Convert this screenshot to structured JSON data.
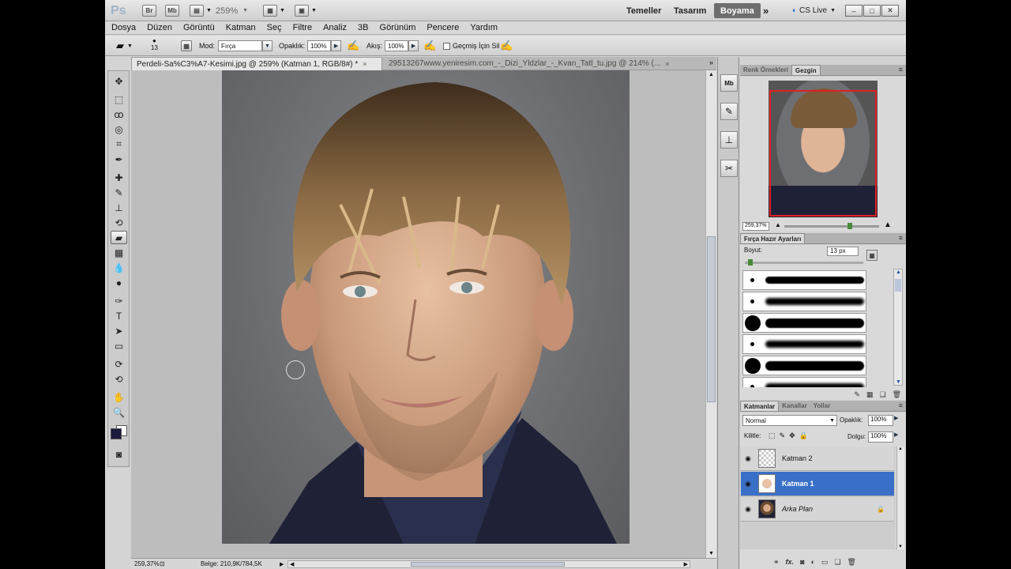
{
  "appbar": {
    "logo": "Ps",
    "bridge_label": "Br",
    "minibridge_label": "Mb",
    "zoom": "259%",
    "workspaces": [
      "Temeller",
      "Tasarım",
      "Boyama"
    ],
    "active_workspace": "Boyama",
    "more": "»",
    "cslive": "CS Live",
    "window_buttons": [
      "–",
      "□",
      "✕"
    ]
  },
  "menu": [
    "Dosya",
    "Düzen",
    "Görüntü",
    "Katman",
    "Seç",
    "Filtre",
    "Analiz",
    "3B",
    "Görünüm",
    "Pencere",
    "Yardım"
  ],
  "options": {
    "brush_size": "13",
    "mode_label": "Mod:",
    "mode_value": "Fırça",
    "opacity_label": "Opaklık:",
    "opacity_value": "100%",
    "flow_label": "Akış:",
    "flow_value": "100%",
    "history_label": "Geçmiş İçin Sil"
  },
  "tabs": [
    {
      "label": "Perdeli-Sa%C3%A7-Kesimi.jpg @ 259% (Katman 1, RGB/8#) *",
      "close": "×"
    },
    {
      "label": "29513267www.yeniresim.com_-_Dizi_Yldzlar_-_Kvan_Tatl_tu.jpg @ 214% (...",
      "close": "×"
    }
  ],
  "tools": [
    "move-tool",
    "marquee-tool",
    "lasso-tool",
    "quick-select-tool",
    "crop-tool",
    "eyedropper-tool",
    "healing-brush-tool",
    "brush-tool",
    "clone-stamp-tool",
    "history-brush-tool",
    "eraser-tool",
    "gradient-tool",
    "blur-tool",
    "dodge-tool",
    "pen-tool",
    "type-tool",
    "path-select-tool",
    "shape-tool",
    "3d-rotate-tool",
    "3d-orbit-tool",
    "hand-tool",
    "zoom-tool"
  ],
  "tool_glyphs": [
    "✥",
    "⬚",
    "ꝏ",
    "◎",
    "⌗",
    "✒",
    "✚",
    "✎",
    "⊥",
    "⟲",
    "▰",
    "▦",
    "💧",
    "●",
    "✑",
    "T",
    "➤",
    "▭",
    "⟳",
    "⟲",
    "✋",
    "🔍"
  ],
  "status": {
    "zoom": "259,37%",
    "doc": "Belge: 210,9K/784,5K"
  },
  "navigator": {
    "tabs": [
      "Renk Örnekleri",
      "Gezgin"
    ],
    "active_tab": "Gezgin",
    "zoom": "259,37%"
  },
  "brush_presets": {
    "title": "Fırça Hazır Ayarları",
    "size_label": "Boyut:",
    "size_value": "13 px"
  },
  "layers": {
    "tabs": [
      "Katmanlar",
      "Kanallar",
      "Yollar"
    ],
    "active_tab": "Katmanlar",
    "blend_mode": "Normal",
    "opacity_label": "Opaklık:",
    "opacity_value": "100%",
    "lock_label": "Kilitle:",
    "fill_label": "Dolgu:",
    "fill_value": "100%",
    "items": [
      {
        "name": "Katman 2",
        "selected": false
      },
      {
        "name": "Katman 1",
        "selected": true
      },
      {
        "name": "Arka Plan",
        "selected": false
      }
    ]
  },
  "colors": {
    "foreground": "#1c1a3c",
    "background": "#ffffff",
    "selection": "#3a6fc8"
  }
}
